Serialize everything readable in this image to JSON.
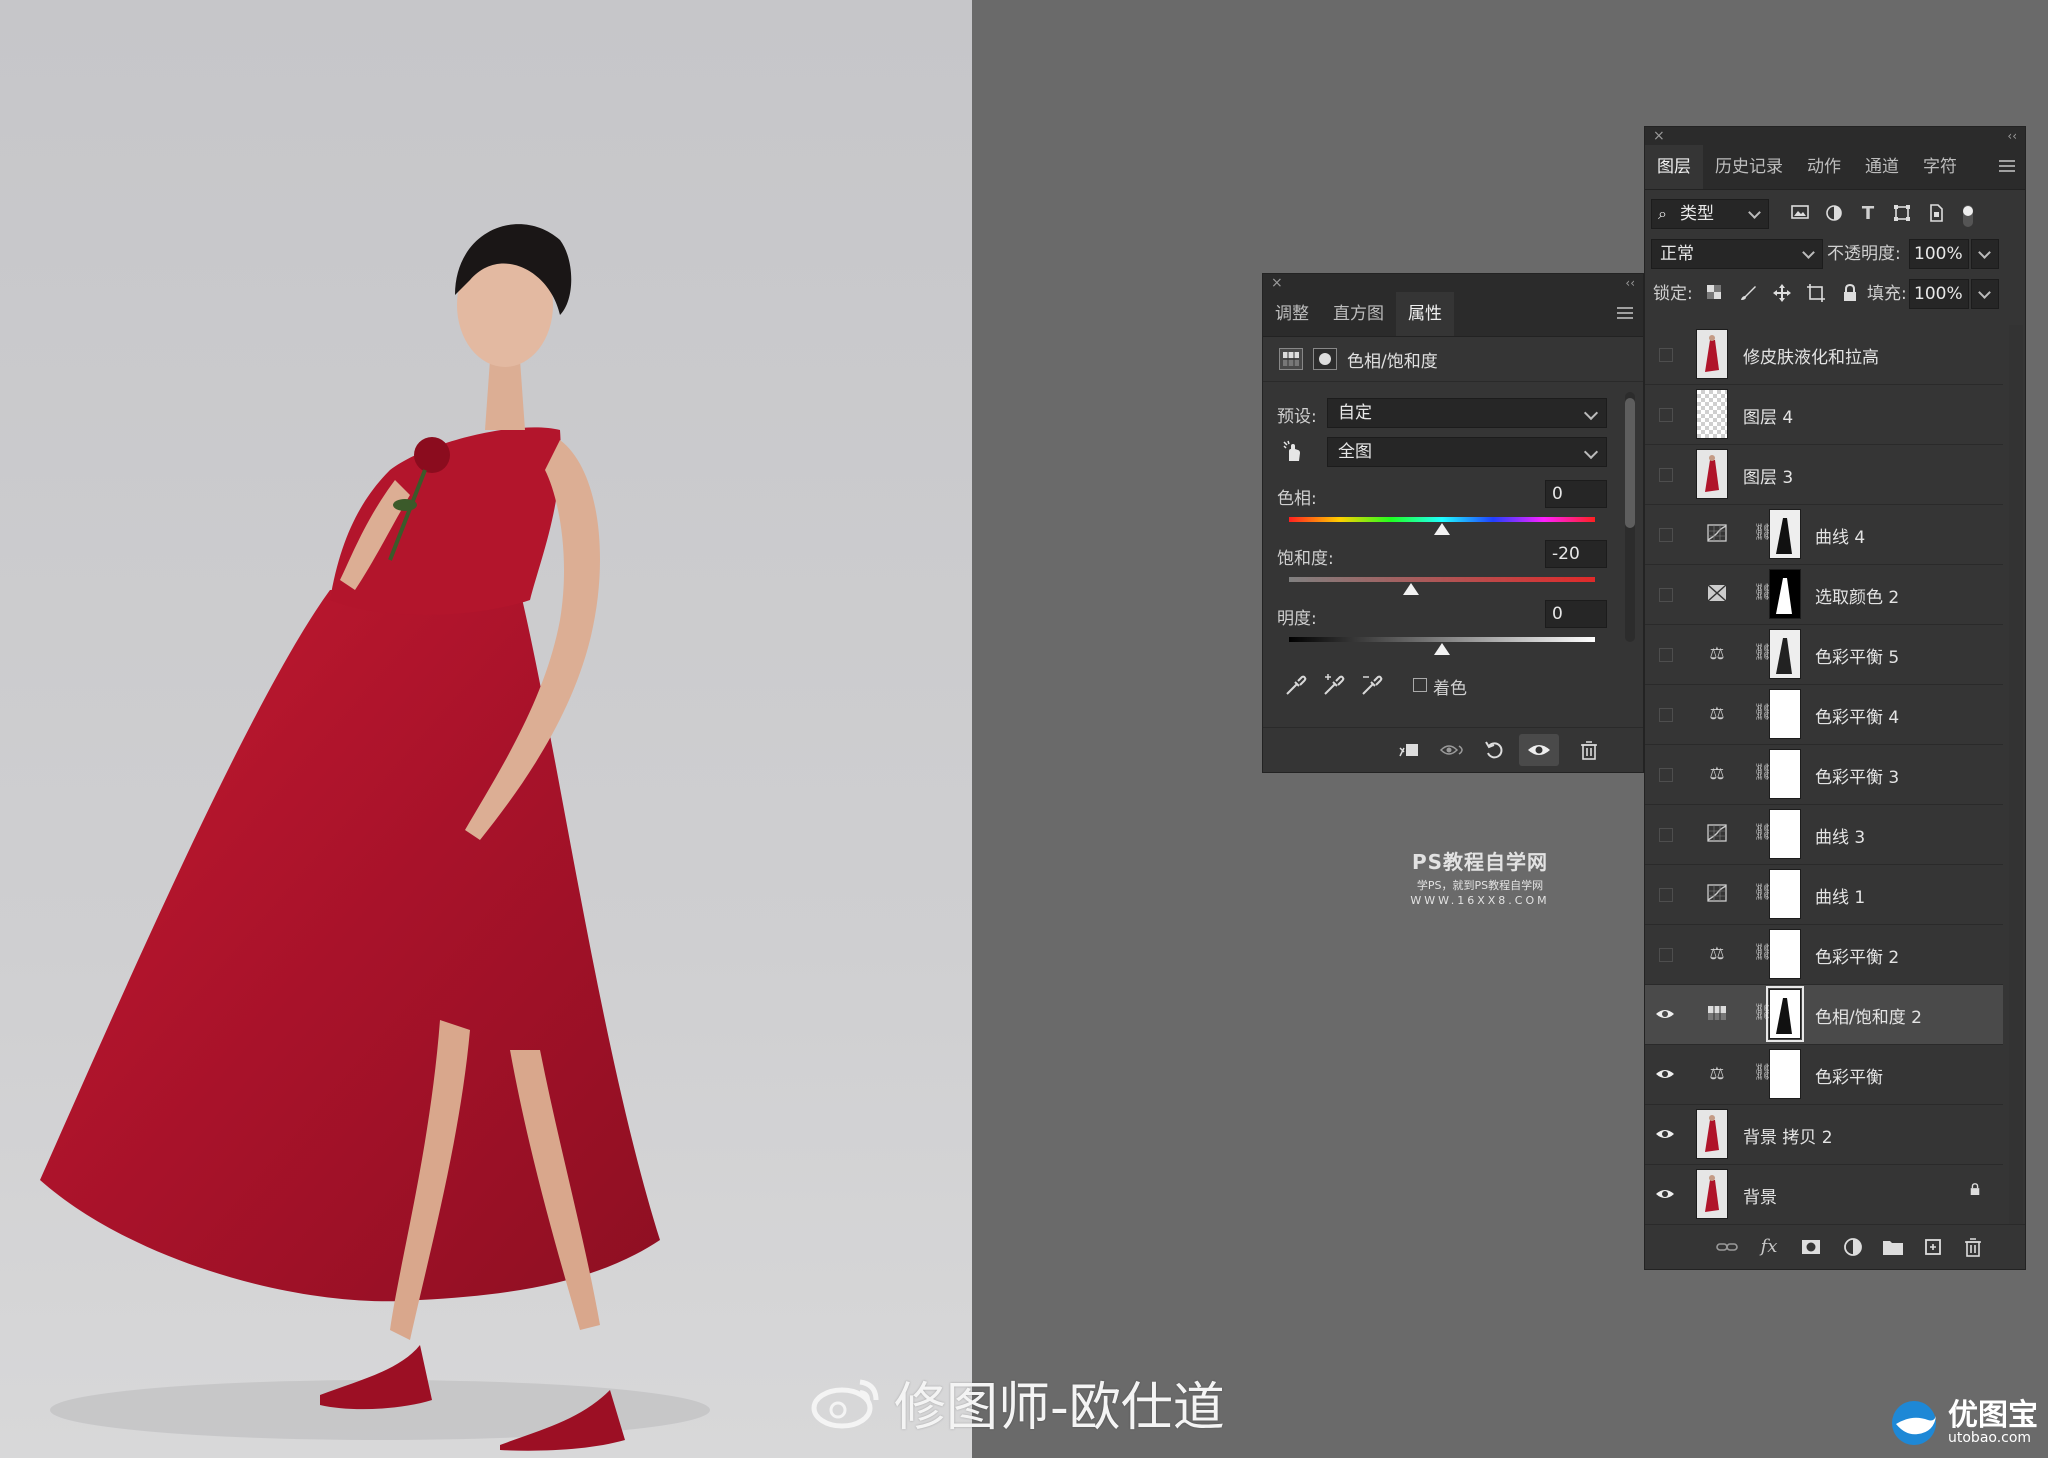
{
  "properties_panel": {
    "tabs": [
      {
        "label": "调整"
      },
      {
        "label": "直方图"
      },
      {
        "label": "属性"
      }
    ],
    "header_title": "色相/饱和度",
    "preset_label": "预设:",
    "preset_value": "自定",
    "channel_value": "全图",
    "hue": {
      "label": "色相:",
      "value": "0",
      "position": 0.5
    },
    "saturation": {
      "label": "饱和度:",
      "value": "-20",
      "position": 0.4
    },
    "lightness": {
      "label": "明度:",
      "value": "0",
      "position": 0.5
    },
    "colorize_label": "着色"
  },
  "layers_panel": {
    "tabs": [
      {
        "label": "图层"
      },
      {
        "label": "历史记录"
      },
      {
        "label": "动作"
      },
      {
        "label": "通道"
      },
      {
        "label": "字符"
      }
    ],
    "filter_kind": "类型",
    "blend_mode": "正常",
    "opacity_label": "不透明度:",
    "opacity_value": "100%",
    "lock_label": "锁定:",
    "fill_label": "填充:",
    "fill_value": "100%",
    "layers": [
      {
        "name": "修皮肤液化和拉高",
        "visible": false,
        "type": "pixel"
      },
      {
        "name": "图层 4",
        "visible": false,
        "type": "transparent"
      },
      {
        "name": "图层 3",
        "visible": false,
        "type": "pixel"
      },
      {
        "name": "曲线 4",
        "visible": false,
        "type": "curves",
        "mask": "silhouette-light"
      },
      {
        "name": "选取颜色 2",
        "visible": false,
        "type": "selective",
        "mask": "silhouette-dark"
      },
      {
        "name": "色彩平衡 5",
        "visible": false,
        "type": "balance",
        "mask": "silhouette-light"
      },
      {
        "name": "色彩平衡 4",
        "visible": false,
        "type": "balance",
        "mask": "white"
      },
      {
        "name": "色彩平衡 3",
        "visible": false,
        "type": "balance",
        "mask": "white"
      },
      {
        "name": "曲线 3",
        "visible": false,
        "type": "curves",
        "mask": "white"
      },
      {
        "name": "曲线 1",
        "visible": false,
        "type": "curves",
        "mask": "white"
      },
      {
        "name": "色彩平衡 2",
        "visible": false,
        "type": "balance",
        "mask": "white"
      },
      {
        "name": "色相/饱和度 2",
        "visible": true,
        "type": "huesat",
        "mask": "silhouette-light",
        "selected": true
      },
      {
        "name": "色彩平衡",
        "visible": true,
        "type": "balance",
        "mask": "white"
      },
      {
        "name": "背景 拷贝 2",
        "visible": true,
        "type": "pixel"
      },
      {
        "name": "背景",
        "visible": true,
        "type": "pixel",
        "locked": true
      }
    ]
  },
  "watermarks": {
    "center_line1": "PS教程自学网",
    "center_line2": "学PS，就到PS教程自学网",
    "center_line3": "WWW.16XX8.COM",
    "bottom_text": "修图师-欧仕道",
    "logo_cn": "优图宝",
    "logo_url": "utobao.com"
  },
  "colors": {
    "workspace": "#6a6a6a",
    "panel": "#353535",
    "dress_red": "#b0142a",
    "backdrop": "#c9c9cb"
  }
}
